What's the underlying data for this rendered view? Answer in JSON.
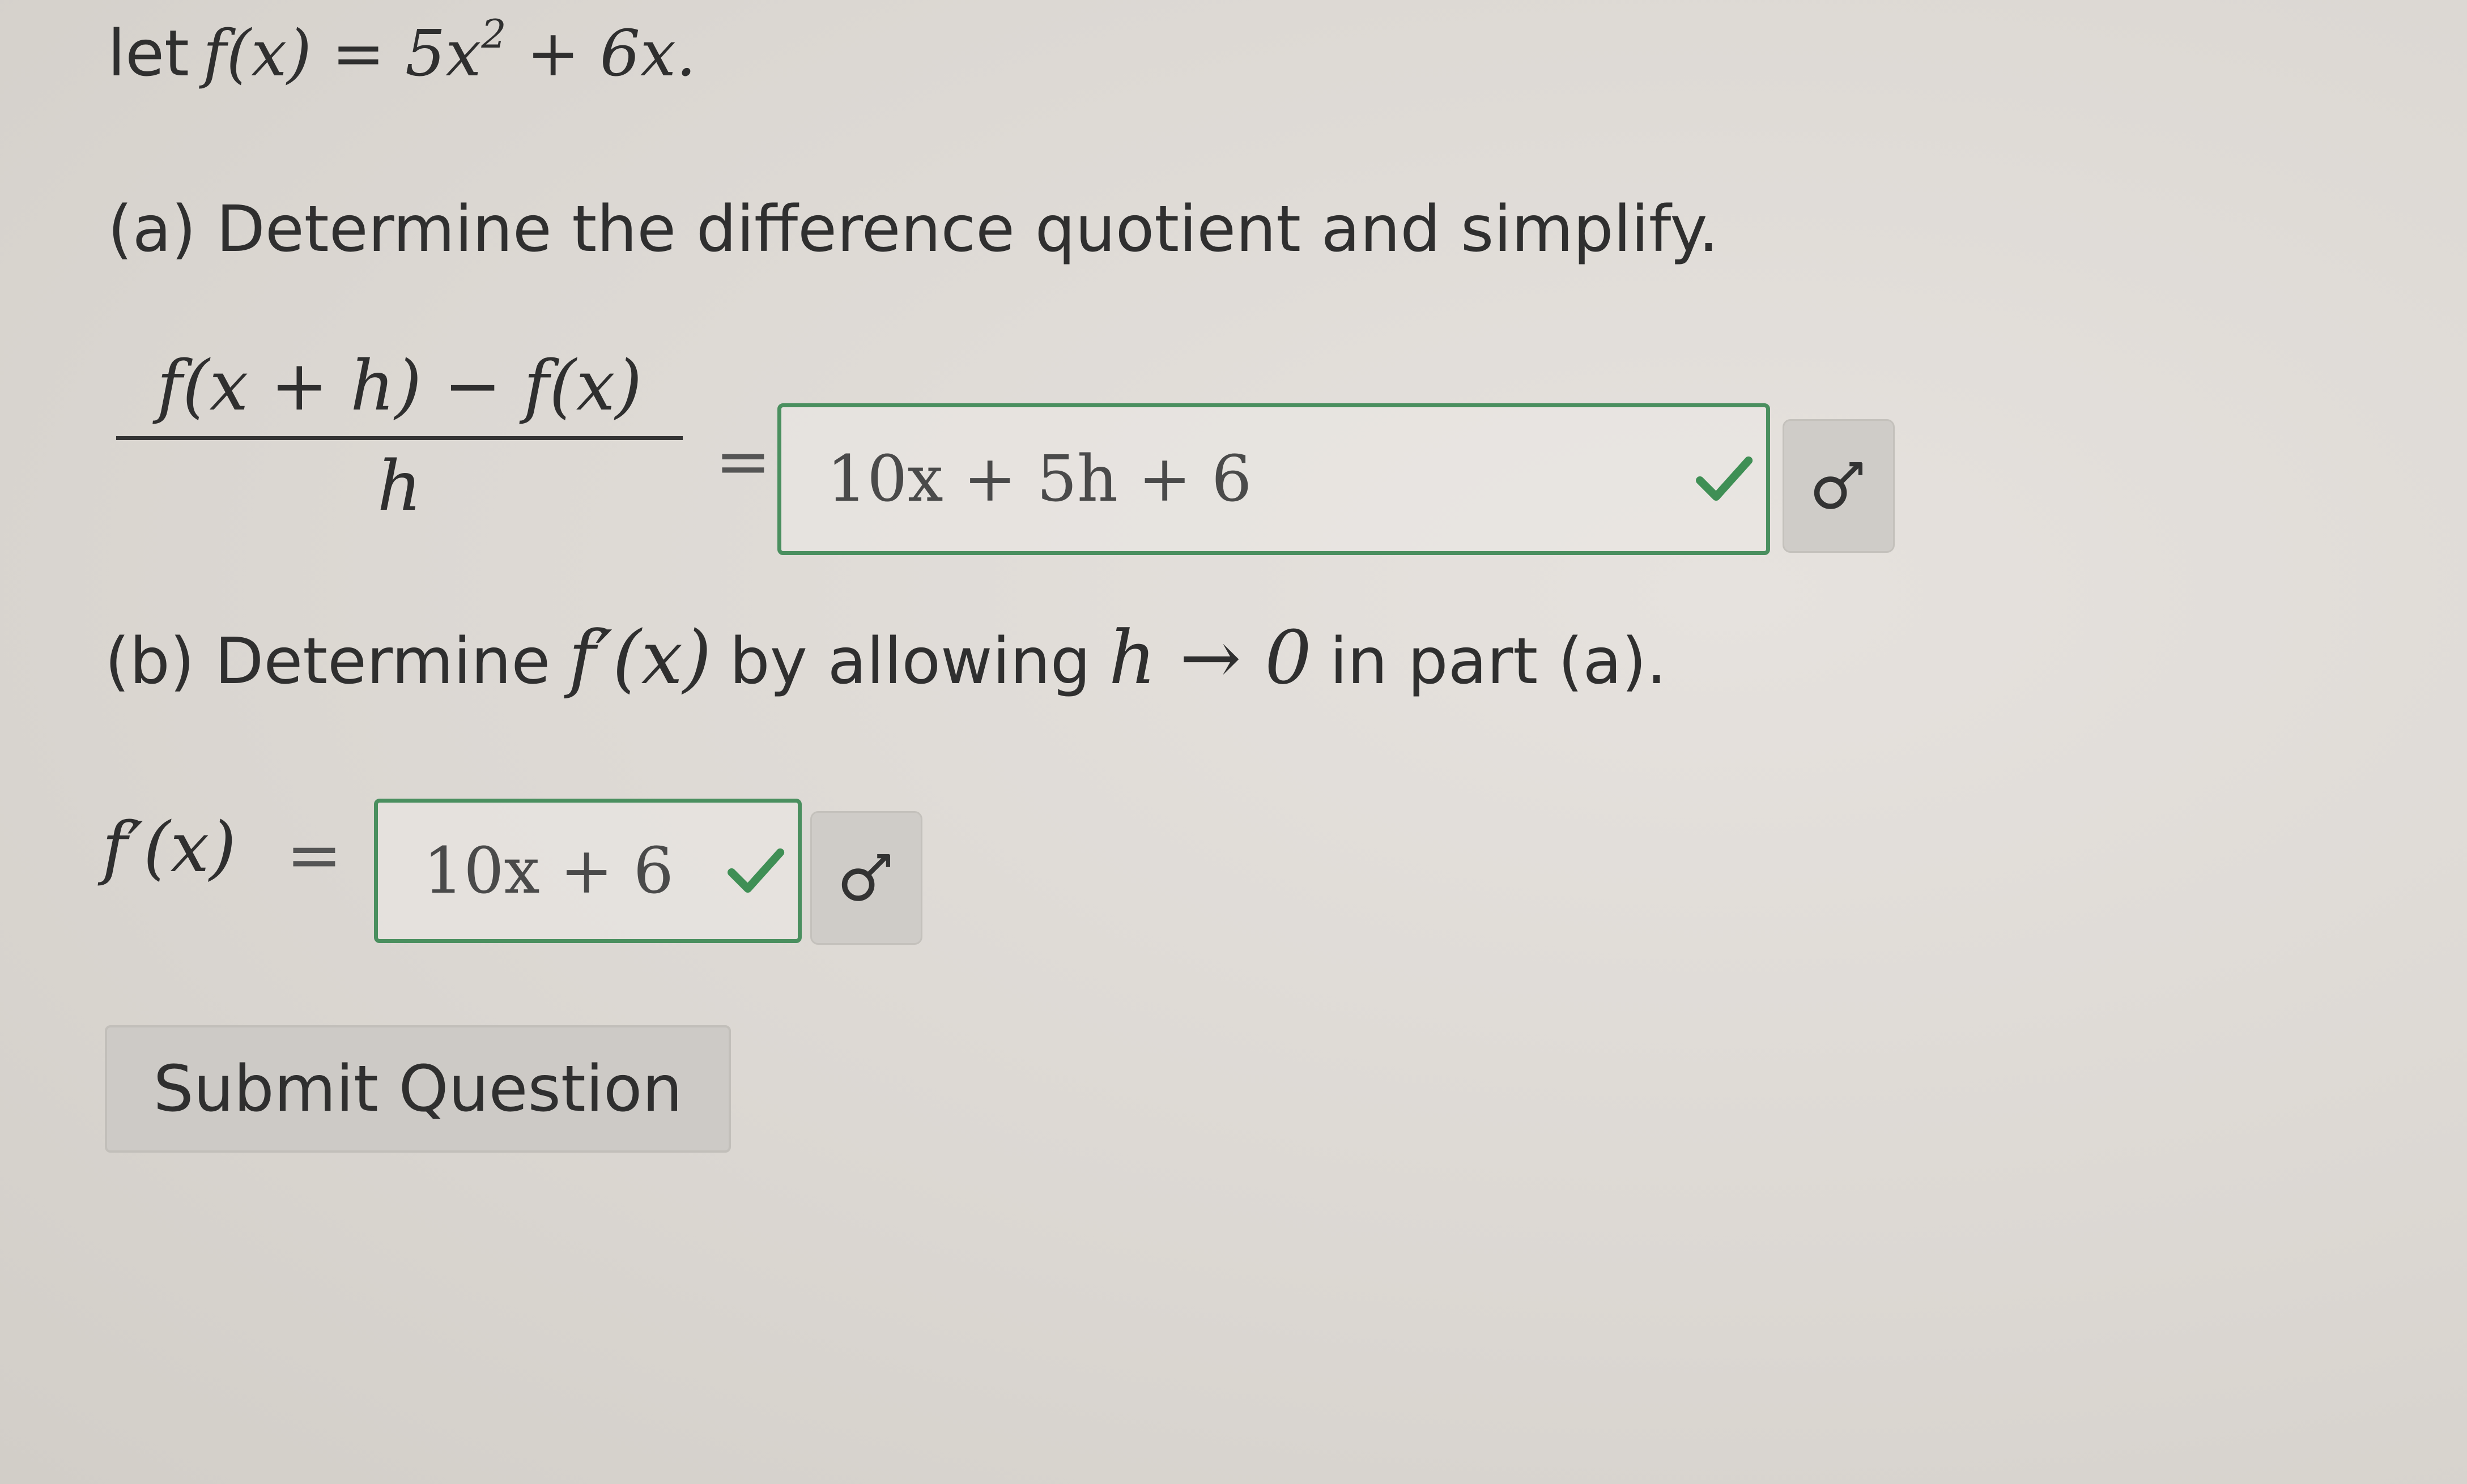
{
  "problem": {
    "let_word": "let",
    "function_def": "f(x) = 5x",
    "exponent": "2",
    "function_tail": "+ 6x."
  },
  "part_a": {
    "prompt": "(a) Determine the difference quotient and simplify.",
    "numerator": "f(x + h) − f(x)",
    "denominator": "h",
    "equals": "=",
    "answer": "10x + 5h + 6",
    "status": "correct",
    "math_button_icon": "math-symbols-icon"
  },
  "part_b": {
    "prompt_start": "(b) Determine",
    "prompt_math1": "f′(x)",
    "prompt_middle": "by allowing",
    "prompt_math2": "h → 0",
    "prompt_end": "in part (a).",
    "label": "f′(x)",
    "equals": "=",
    "answer": "10x + 6",
    "status": "correct",
    "math_button_icon": "math-symbols-icon"
  },
  "submit": {
    "label": "Submit Question"
  },
  "colors": {
    "correct_green": "#3f8f55",
    "background": "#dedad5"
  }
}
